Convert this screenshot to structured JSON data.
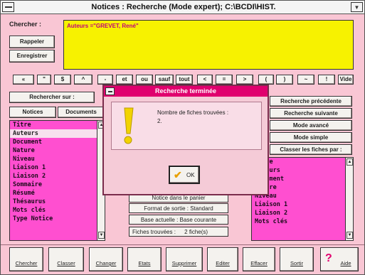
{
  "window": {
    "title": "Notices : Recherche (Mode expert); C:\\BCDI\\HIST."
  },
  "search": {
    "label": "Chercher :",
    "query": "Auteurs =\"GREVET, René\"",
    "rappeler": "Rappeler",
    "enregistrer": "Enregistrer"
  },
  "operators": [
    "«",
    "\"",
    "$",
    "^",
    "-",
    "et",
    "ou",
    "sauf",
    "tout",
    "<",
    "=",
    ">",
    "(",
    ")",
    "~",
    "!",
    "Vide"
  ],
  "search_on": {
    "label": "Rechercher sur :",
    "tab_notices": "Notices",
    "tab_documents": "Documents",
    "fields": [
      "Titre",
      "Auteurs",
      "Document",
      "Nature",
      "Niveau",
      "Liaison 1",
      "Liaison 2",
      "Sommaire",
      "Résumé",
      "Thésaurus",
      "Mots clés",
      "Type Notice"
    ],
    "selected_index": 1
  },
  "center": {
    "hidden_button": "Notice dans le panier",
    "format": "Format de sortie : Standard",
    "base": "Base actuelle : Base courante",
    "found_label": "Fiches trouvées :",
    "found_value": "2 fiche(s)"
  },
  "right_panel": {
    "prev": "Recherche précédente",
    "next": "Recherche suivante",
    "advanced": "Mode avancé",
    "simple": "Mode simple",
    "sort": "Classer les fiches  par :",
    "fields": [
      "Titre",
      "Auteurs",
      "Document",
      "Nature",
      "Niveau",
      "Liaison 1",
      "Liaison 2",
      "Mots clés"
    ]
  },
  "dialog": {
    "title": "Recherche terminée",
    "message_line1": "Nombre de fiches trouvées :",
    "message_line2": "2.",
    "ok": "OK",
    "icon": "exclamation-icon"
  },
  "toolbar": [
    "Chercher",
    "Classer",
    "Changer",
    "Etats",
    "Supprimer",
    "Editer",
    "Effacer",
    "Sortir",
    "Aide"
  ],
  "colors": {
    "pink_list": "#ff4fd0",
    "yellow_query": "#f7f200",
    "dialog_title": "#e0006e",
    "window_bg": "#f9c6d4"
  }
}
